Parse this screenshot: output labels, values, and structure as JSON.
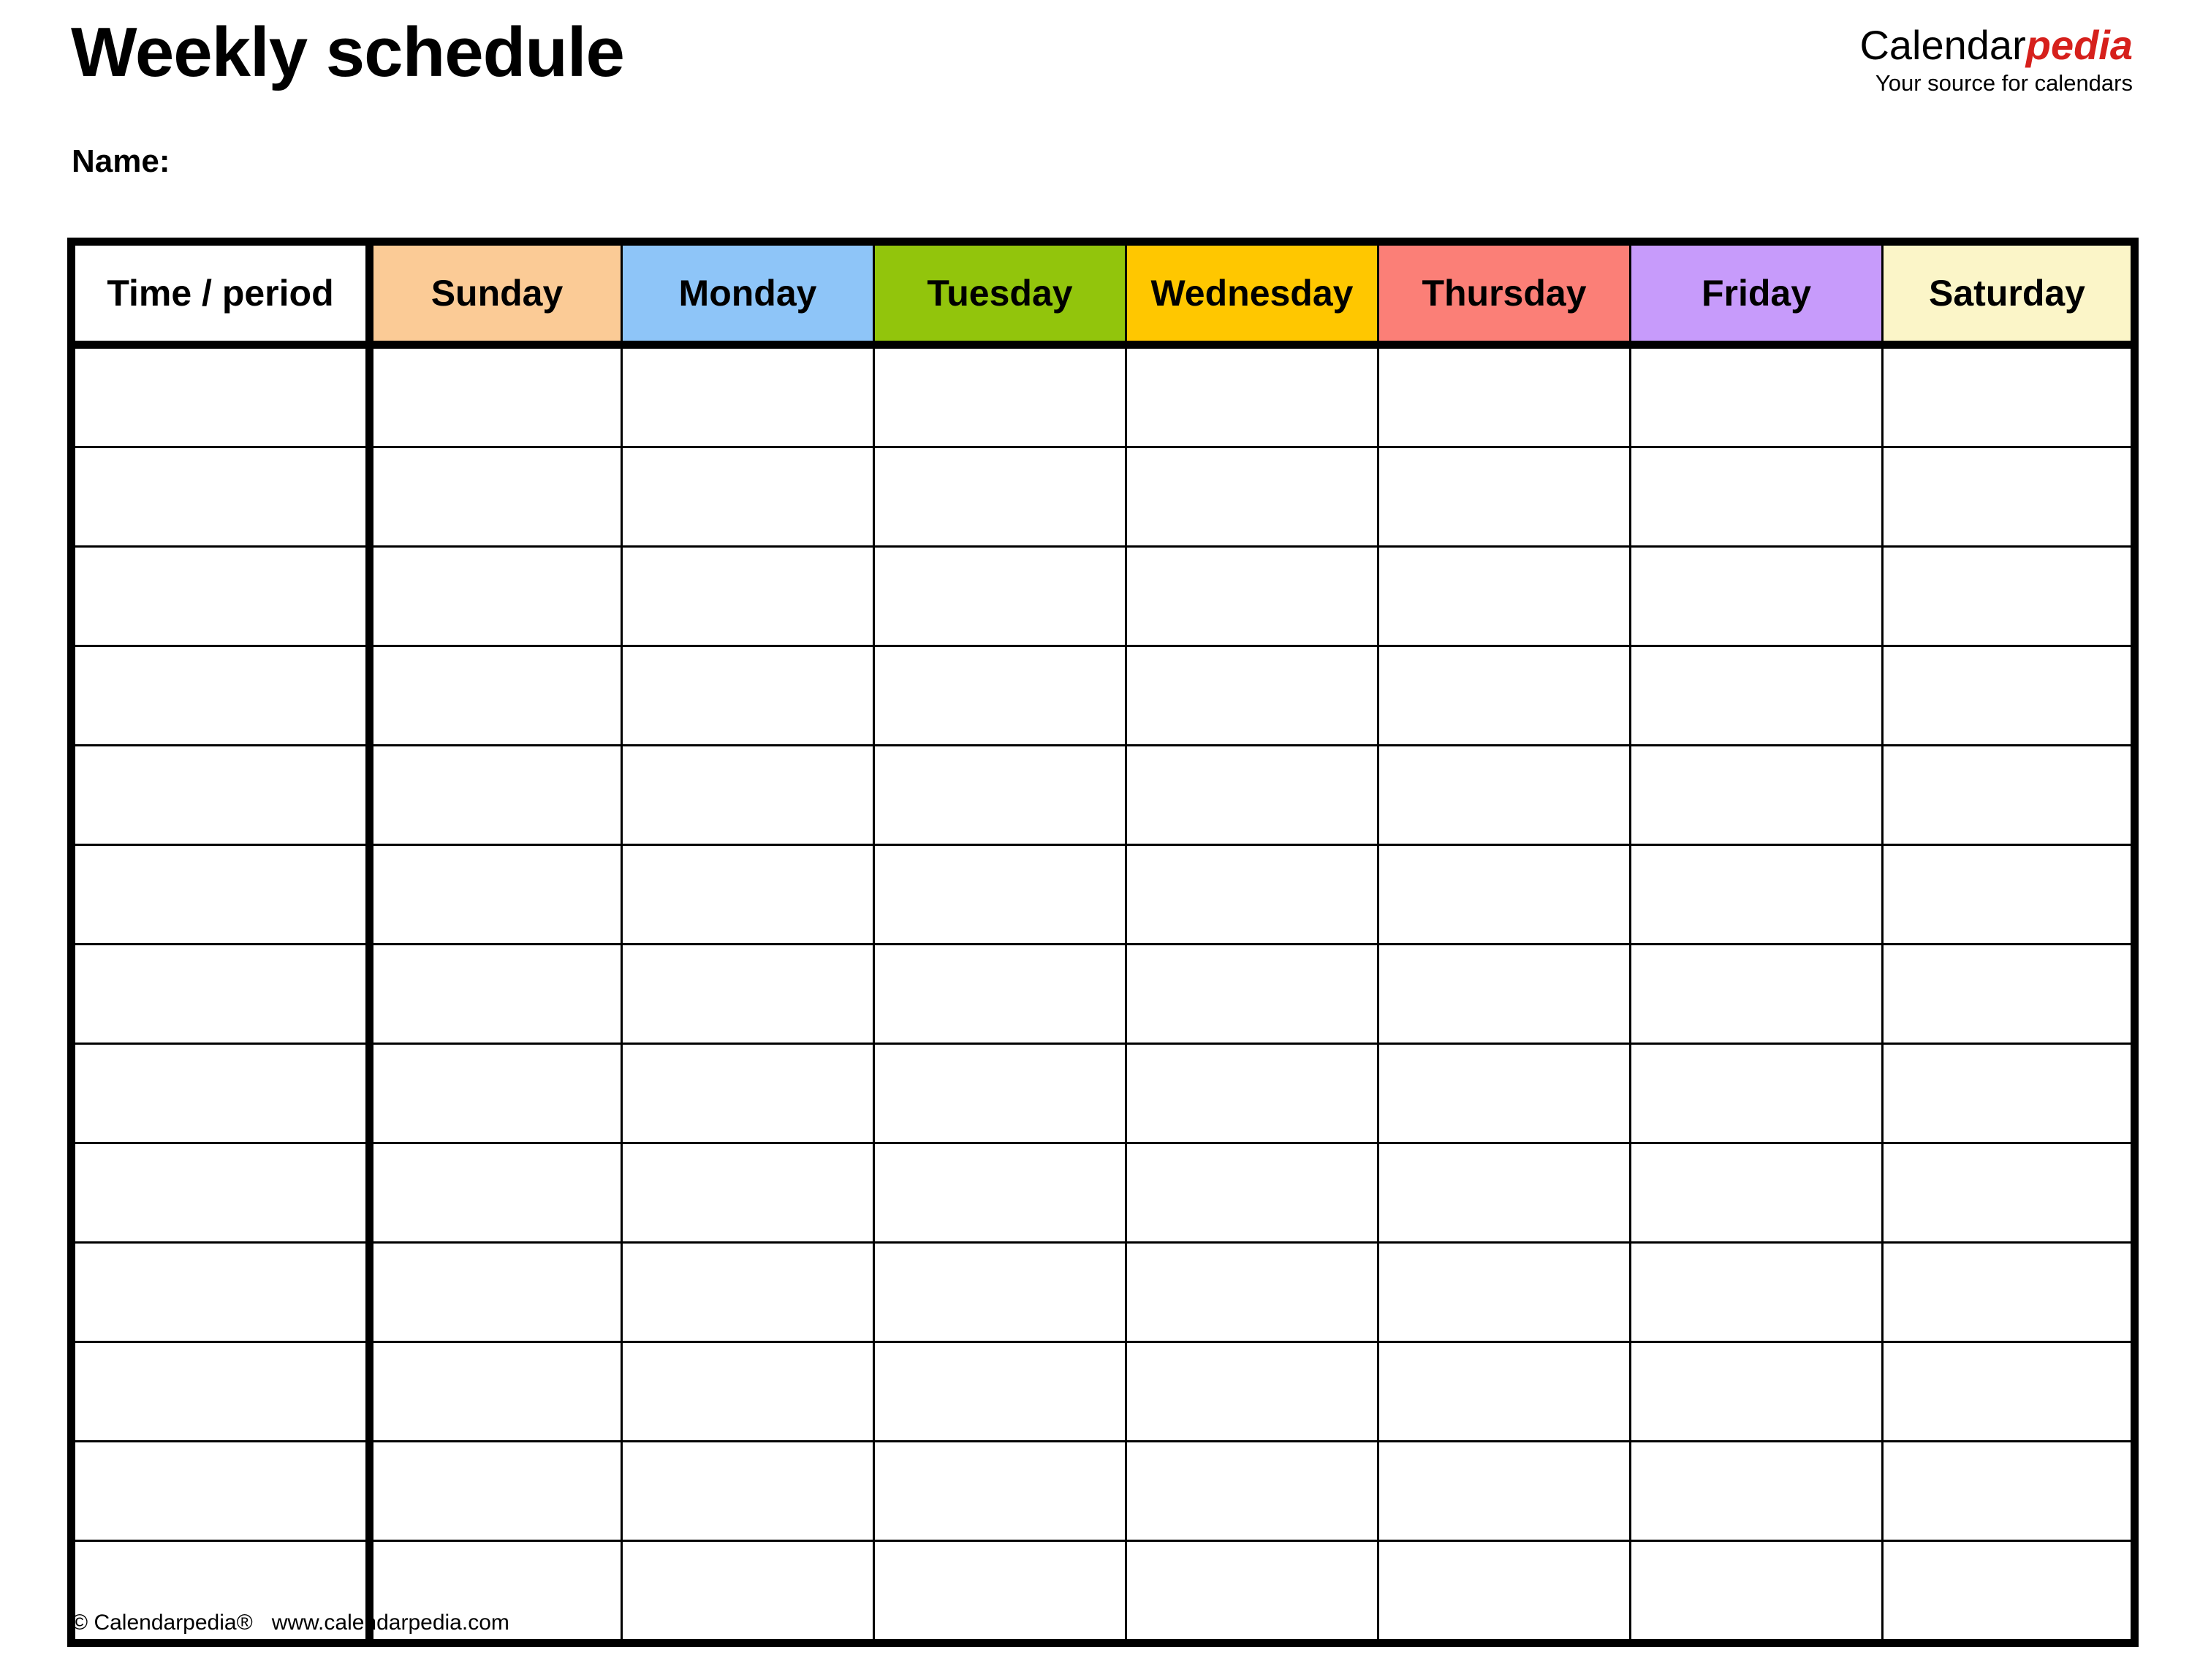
{
  "document": {
    "title": "Weekly schedule",
    "name_label": "Name:"
  },
  "brand": {
    "word_first": "Calendar",
    "word_second": "pedia",
    "tagline": "Your source for calendars",
    "accent_color": "#d6201c"
  },
  "table": {
    "columns": [
      {
        "label": "Time / period",
        "color": "#ffffff",
        "key": "time"
      },
      {
        "label": "Sunday",
        "color": "#fbcb96",
        "key": "sunday"
      },
      {
        "label": "Monday",
        "color": "#8ec5f8",
        "key": "monday"
      },
      {
        "label": "Tuesday",
        "color": "#92c50c",
        "key": "tuesday"
      },
      {
        "label": "Wednesday",
        "color": "#ffc700",
        "key": "wednesday"
      },
      {
        "label": "Thursday",
        "color": "#fb7f77",
        "key": "thursday"
      },
      {
        "label": "Friday",
        "color": "#c79bfb",
        "key": "friday"
      },
      {
        "label": "Saturday",
        "color": "#fbf5c8",
        "key": "saturday"
      }
    ],
    "row_count": 13,
    "rows": [
      {
        "time": "",
        "sunday": "",
        "monday": "",
        "tuesday": "",
        "wednesday": "",
        "thursday": "",
        "friday": "",
        "saturday": ""
      },
      {
        "time": "",
        "sunday": "",
        "monday": "",
        "tuesday": "",
        "wednesday": "",
        "thursday": "",
        "friday": "",
        "saturday": ""
      },
      {
        "time": "",
        "sunday": "",
        "monday": "",
        "tuesday": "",
        "wednesday": "",
        "thursday": "",
        "friday": "",
        "saturday": ""
      },
      {
        "time": "",
        "sunday": "",
        "monday": "",
        "tuesday": "",
        "wednesday": "",
        "thursday": "",
        "friday": "",
        "saturday": ""
      },
      {
        "time": "",
        "sunday": "",
        "monday": "",
        "tuesday": "",
        "wednesday": "",
        "thursday": "",
        "friday": "",
        "saturday": ""
      },
      {
        "time": "",
        "sunday": "",
        "monday": "",
        "tuesday": "",
        "wednesday": "",
        "thursday": "",
        "friday": "",
        "saturday": ""
      },
      {
        "time": "",
        "sunday": "",
        "monday": "",
        "tuesday": "",
        "wednesday": "",
        "thursday": "",
        "friday": "",
        "saturday": ""
      },
      {
        "time": "",
        "sunday": "",
        "monday": "",
        "tuesday": "",
        "wednesday": "",
        "thursday": "",
        "friday": "",
        "saturday": ""
      },
      {
        "time": "",
        "sunday": "",
        "monday": "",
        "tuesday": "",
        "wednesday": "",
        "thursday": "",
        "friday": "",
        "saturday": ""
      },
      {
        "time": "",
        "sunday": "",
        "monday": "",
        "tuesday": "",
        "wednesday": "",
        "thursday": "",
        "friday": "",
        "saturday": ""
      },
      {
        "time": "",
        "sunday": "",
        "monday": "",
        "tuesday": "",
        "wednesday": "",
        "thursday": "",
        "friday": "",
        "saturday": ""
      },
      {
        "time": "",
        "sunday": "",
        "monday": "",
        "tuesday": "",
        "wednesday": "",
        "thursday": "",
        "friday": "",
        "saturday": ""
      },
      {
        "time": "",
        "sunday": "",
        "monday": "",
        "tuesday": "",
        "wednesday": "",
        "thursday": "",
        "friday": "",
        "saturday": ""
      }
    ]
  },
  "footer": {
    "copyright": "© Calendarpedia®",
    "url": "www.calendarpedia.com"
  }
}
